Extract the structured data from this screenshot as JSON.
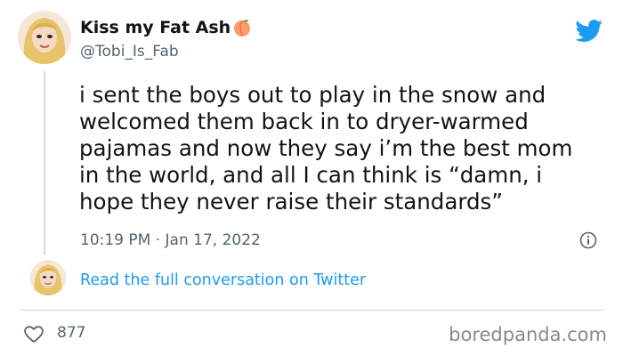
{
  "tweet": {
    "display_name": "Kiss my Fat Ash",
    "handle": "@Tobi_Is_Fab",
    "text": "i sent the boys out to play in the snow and\nwelcomed them back in to dryer-warmed\npajamas and now they say i’m the best mom\nin the world, and all I can think is “damn, i\nhope they never raise their standards”",
    "timestamp": "10:19 PM · Jan 17, 2022",
    "read_more": "Read the full conversation on Twitter",
    "like_count": "877"
  },
  "icons": {
    "logo": "twitter-bird-icon",
    "info": "info-icon",
    "like": "heart-icon",
    "emoji": "peach-emoji-icon"
  },
  "colors": {
    "link": "#1d9bf0",
    "secondary_text": "#536471",
    "primary_text": "#0f1419"
  },
  "watermark": "boredpanda.com"
}
